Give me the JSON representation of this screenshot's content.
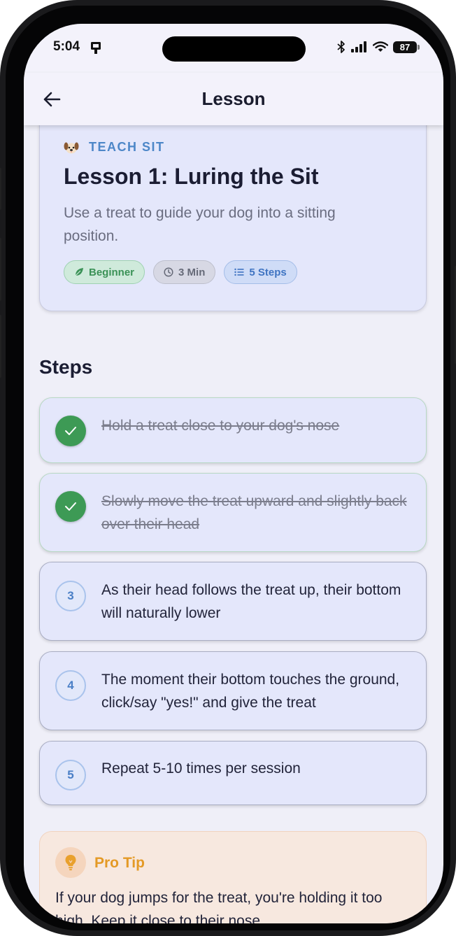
{
  "status_bar": {
    "time": "5:04",
    "battery": "87"
  },
  "app_bar": {
    "title": "Lesson"
  },
  "lesson": {
    "category": "TEACH SIT",
    "title": "Lesson 1: Luring the Sit",
    "description": "Use a treat to guide your dog into a sitting position.",
    "chips": {
      "level": "Beginner",
      "duration": "3 Min",
      "steps": "5 Steps"
    }
  },
  "steps_heading": "Steps",
  "steps": [
    {
      "number": "1",
      "text": "Hold a treat close to your dog's nose",
      "completed": true
    },
    {
      "number": "2",
      "text": "Slowly move the treat upward and slightly back over their head",
      "completed": true
    },
    {
      "number": "3",
      "text": "As their head follows the treat up, their bottom will naturally lower",
      "completed": false
    },
    {
      "number": "4",
      "text": "The moment their bottom touches the ground, click/say \"yes!\" and give the treat",
      "completed": false
    },
    {
      "number": "5",
      "text": "Repeat 5-10 times per session",
      "completed": false
    }
  ],
  "tip": {
    "title": "Pro Tip",
    "text": "If your dog jumps for the treat, you're holding it too high. Keep it close to their nose."
  },
  "colors": {
    "accent_blue": "#4d87c8",
    "success_green": "#3d9a55",
    "tip_orange": "#e49a26",
    "card_background": "#e4e7fb"
  },
  "icons": {
    "back": "arrow-left-icon",
    "category": "dog-face-icon",
    "level": "leaf-icon",
    "duration": "clock-icon",
    "steps": "list-icon",
    "completed": "check-icon",
    "tip": "lightbulb-icon"
  }
}
